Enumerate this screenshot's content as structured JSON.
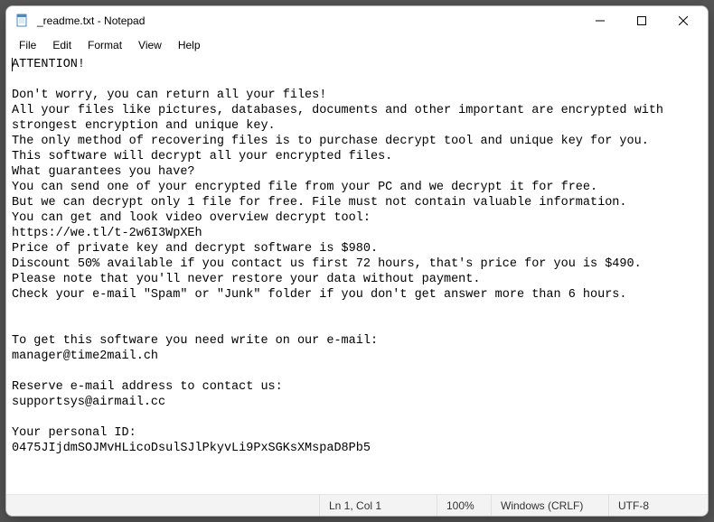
{
  "window": {
    "title": "_readme.txt - Notepad",
    "icon_name": "notepad-icon"
  },
  "menu": {
    "items": [
      "File",
      "Edit",
      "Format",
      "View",
      "Help"
    ]
  },
  "document": {
    "text": "ATTENTION!\n\nDon't worry, you can return all your files!\nAll your files like pictures, databases, documents and other important are encrypted with strongest encryption and unique key.\nThe only method of recovering files is to purchase decrypt tool and unique key for you.\nThis software will decrypt all your encrypted files.\nWhat guarantees you have?\nYou can send one of your encrypted file from your PC and we decrypt it for free.\nBut we can decrypt only 1 file for free. File must not contain valuable information.\nYou can get and look video overview decrypt tool:\nhttps://we.tl/t-2w6I3WpXEh\nPrice of private key and decrypt software is $980.\nDiscount 50% available if you contact us first 72 hours, that's price for you is $490.\nPlease note that you'll never restore your data without payment.\nCheck your e-mail \"Spam\" or \"Junk\" folder if you don't get answer more than 6 hours.\n\n\nTo get this software you need write on our e-mail:\nmanager@time2mail.ch\n\nReserve e-mail address to contact us:\nsupportsys@airmail.cc\n\nYour personal ID:\n0475JIjdmSOJMvHLicoDsulSJlPkyvLi9PxSGKsXMspaD8Pb5"
  },
  "status": {
    "position": "Ln 1, Col 1",
    "zoom": "100%",
    "line_ending": "Windows (CRLF)",
    "encoding": "UTF-8"
  }
}
